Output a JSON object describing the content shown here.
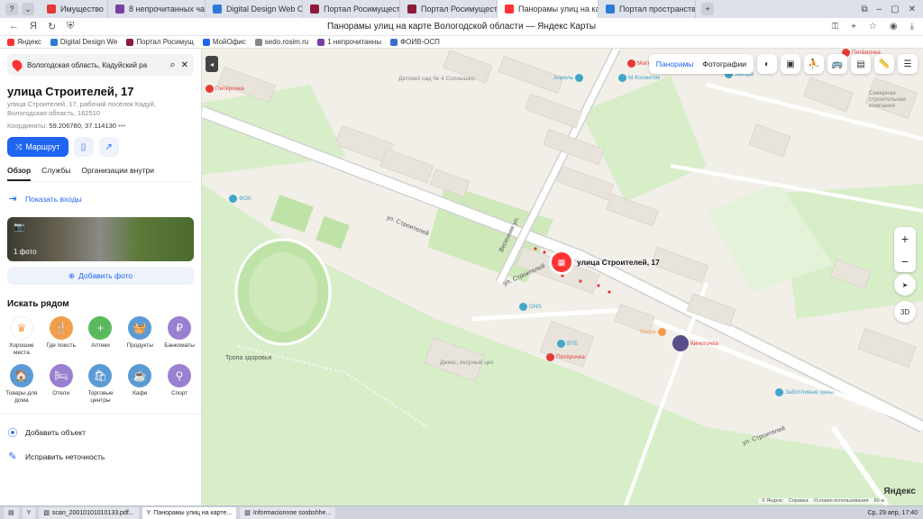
{
  "browser": {
    "window_title": "Панорамы улиц на карте Вологодской области — Яндекс Карты",
    "tabs": [
      {
        "label": "Имущество",
        "color": "#e53935",
        "active": false
      },
      {
        "label": "8 непрочитанных чатов",
        "color": "#7b3fa0",
        "active": false
      },
      {
        "label": "Digital Design Web Client",
        "color": "#2b7bd6",
        "active": false
      },
      {
        "label": "Портал Росимущества",
        "color": "#8e1b3a",
        "active": false
      },
      {
        "label": "Портал Росимущества",
        "color": "#8e1b3a",
        "active": false
      },
      {
        "label": "Панорамы улиц на карт",
        "color": "#f33",
        "active": true
      },
      {
        "label": "Портал пространственн",
        "color": "#2b7bd6",
        "active": false
      }
    ],
    "bookmarks": [
      {
        "label": "Яндекс",
        "color": "#f33"
      },
      {
        "label": "Digital Design We",
        "color": "#2b7bd6"
      },
      {
        "label": "Портал Росимущ",
        "color": "#8e1b3a"
      },
      {
        "label": "МойОфис",
        "color": "#1f65f1"
      },
      {
        "label": "sedo.rosim.ru",
        "color": "#888"
      },
      {
        "label": "1 непрочитанны",
        "color": "#7b3fa0"
      },
      {
        "label": "ФОИВ-ОСП",
        "color": "#3a6fd0"
      }
    ]
  },
  "sidebar": {
    "search_value": "Вологодская область, Кадуйский ра",
    "title": "улица Строителей, 17",
    "address_line1": "улица Строителей, 17, рабочий посёлок Кадуй,",
    "address_line2": "Вологодская область, 162510",
    "coords_label": "Координаты:",
    "coords_value": "59.206780, 37.114130",
    "route_label": "Маршрут",
    "tabs": [
      "Обзор",
      "Службы",
      "Организации внутри"
    ],
    "show_entrances": "Показать входы",
    "photo_count": "1 фото",
    "add_photo": "Добавить фото",
    "nearby_title": "Искать рядом",
    "categories": [
      {
        "label": "Хорошие места",
        "color": "#ffffff",
        "icon": "♛"
      },
      {
        "label": "Где поесть",
        "color": "#f29d4b",
        "icon": "🍴"
      },
      {
        "label": "Аптеки",
        "color": "#5cb85c",
        "icon": "+"
      },
      {
        "label": "Продукты",
        "color": "#5b9bd5",
        "icon": "🧺"
      },
      {
        "label": "Банкоматы",
        "color": "#9b7fd0",
        "icon": "₽"
      },
      {
        "label": "Товары для дома",
        "color": "#5b9bd5",
        "icon": "🏠"
      },
      {
        "label": "Отели",
        "color": "#9b7fd0",
        "icon": "🛏"
      },
      {
        "label": "Торговые центры",
        "color": "#5b9bd5",
        "icon": "🛍"
      },
      {
        "label": "Кафе",
        "color": "#5b9bd5",
        "icon": "☕"
      },
      {
        "label": "Спорт",
        "color": "#9b7fd0",
        "icon": "⚲"
      }
    ],
    "add_object": "Добавить объект",
    "fix_error": "Исправить неточность"
  },
  "map": {
    "panoramas_label": "Панорамы",
    "photos_label": "Фотографии",
    "pin_label": "улица Строителей, 17",
    "btn_3d": "3D",
    "streets": [
      "ул. Строителей",
      "ул. Строителей",
      "ул. Строителей",
      "Весенняя ул.",
      "Тропа здоровья"
    ],
    "pois": [
      {
        "label": "Пятёрочка",
        "color": "#e53935"
      },
      {
        "label": "Магнит",
        "color": "#e53935"
      },
      {
        "label": "М.Косметик",
        "color": "#43a5c8"
      },
      {
        "label": "Апрель",
        "color": "#43a5c8"
      },
      {
        "label": "Звезда",
        "color": "#43a5c8"
      },
      {
        "label": "ФОК",
        "color": "#43a5c8"
      },
      {
        "label": "DNS",
        "color": "#43a5c8"
      },
      {
        "label": "ВТБ",
        "color": "#43a5c8"
      },
      {
        "label": "Пятёрочка",
        "color": "#e53935"
      },
      {
        "label": "Якорь",
        "color": "#f29d4b"
      },
      {
        "label": "Киноточка",
        "color": "#e53935"
      },
      {
        "label": "Заботливые цены",
        "color": "#43a5c8"
      },
      {
        "label": "Пятёрочка",
        "color": "#e53935"
      },
      {
        "label": "Детский сад № 4 Солнышко",
        "color": "#888"
      },
      {
        "label": "Северная строительная компания",
        "color": "#888"
      },
      {
        "label": "Джекс, ексрный цех",
        "color": "#888"
      }
    ],
    "copyright": [
      "© Яндекс",
      "Справка",
      "Условия использования"
    ],
    "scale": "60 м",
    "logo": "Яндекс"
  },
  "taskbar": {
    "items": [
      "scan_20010101010133.pdf...",
      "Панорамы улиц на карте...",
      "Informacionnoe soobshhe..."
    ],
    "clock": "Ср, 29 апр, 17:40"
  }
}
